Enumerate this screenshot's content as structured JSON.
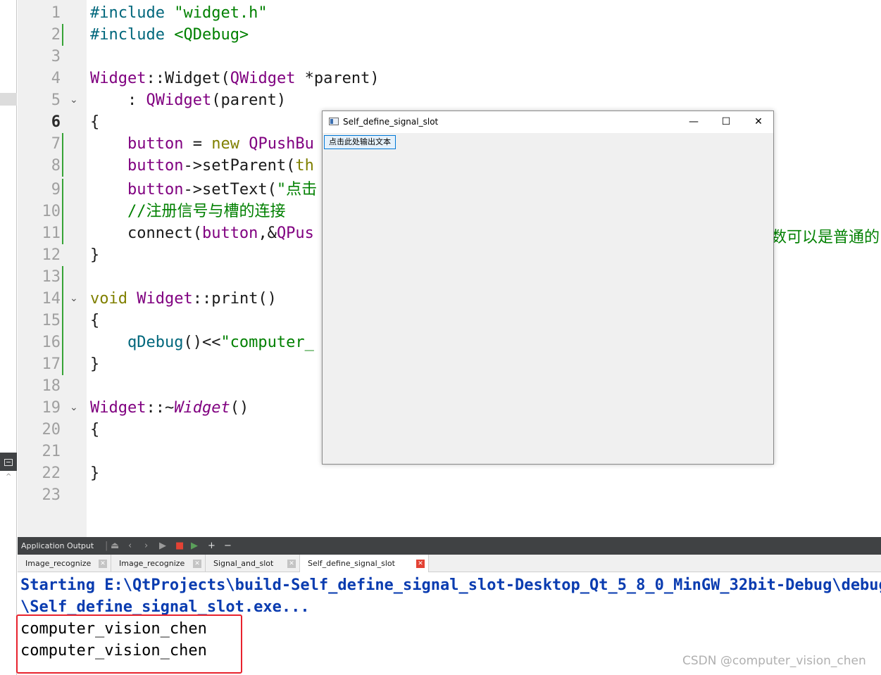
{
  "editor": {
    "lines": [
      {
        "n": "1",
        "code": [
          {
            "t": "#include ",
            "c": "pp"
          },
          {
            "t": "\"widget.h\"",
            "c": "str"
          }
        ]
      },
      {
        "n": "2",
        "code": [
          {
            "t": "#include ",
            "c": "pp"
          },
          {
            "t": "<QDebug>",
            "c": "str"
          }
        ]
      },
      {
        "n": "3",
        "code": []
      },
      {
        "n": "4",
        "code": [
          {
            "t": "Widget",
            "c": "ty"
          },
          {
            "t": "::",
            "c": ""
          },
          {
            "t": "Widget",
            "c": ""
          },
          {
            "t": "(",
            "c": ""
          },
          {
            "t": "QWidget",
            "c": "ty"
          },
          {
            "t": " *parent)",
            "c": ""
          }
        ]
      },
      {
        "n": "5",
        "fold": "⌄",
        "code": [
          {
            "t": "    : ",
            "c": ""
          },
          {
            "t": "QWidget",
            "c": "ty"
          },
          {
            "t": "(parent)",
            "c": ""
          }
        ]
      },
      {
        "n": "6",
        "current": true,
        "code": [
          {
            "t": "{",
            "c": ""
          }
        ]
      },
      {
        "n": "7",
        "code": [
          {
            "t": "    button",
            "c": "ty"
          },
          {
            "t": " = ",
            "c": ""
          },
          {
            "t": "new",
            "c": "kw"
          },
          {
            "t": " ",
            "c": ""
          },
          {
            "t": "QPushBu",
            "c": "ty"
          }
        ]
      },
      {
        "n": "8",
        "code": [
          {
            "t": "    button",
            "c": "ty"
          },
          {
            "t": "->setParent(",
            "c": ""
          },
          {
            "t": "th",
            "c": "kw"
          }
        ]
      },
      {
        "n": "9",
        "code": [
          {
            "t": "    button",
            "c": "ty"
          },
          {
            "t": "->setText(",
            "c": ""
          },
          {
            "t": "\"点击",
            "c": "str"
          }
        ]
      },
      {
        "n": "10",
        "code": [
          {
            "t": "    //注册信号与槽的连接",
            "c": "com"
          }
        ]
      },
      {
        "n": "11",
        "code": [
          {
            "t": "    connect(",
            "c": ""
          },
          {
            "t": "button",
            "c": "ty"
          },
          {
            "t": ",&",
            "c": ""
          },
          {
            "t": "QPus",
            "c": "ty"
          }
        ]
      },
      {
        "n": "12",
        "code": [
          {
            "t": "}",
            "c": ""
          }
        ]
      },
      {
        "n": "13",
        "code": []
      },
      {
        "n": "14",
        "fold": "⌄",
        "code": [
          {
            "t": "void",
            "c": "kw"
          },
          {
            "t": " ",
            "c": ""
          },
          {
            "t": "Widget",
            "c": "ty"
          },
          {
            "t": "::print()",
            "c": ""
          }
        ]
      },
      {
        "n": "15",
        "code": [
          {
            "t": "{",
            "c": ""
          }
        ]
      },
      {
        "n": "16",
        "code": [
          {
            "t": "    qDebug",
            "c": "fn"
          },
          {
            "t": "()<<",
            "c": ""
          },
          {
            "t": "\"computer_",
            "c": "str"
          }
        ]
      },
      {
        "n": "17",
        "code": [
          {
            "t": "}",
            "c": ""
          }
        ]
      },
      {
        "n": "18",
        "code": []
      },
      {
        "n": "19",
        "fold": "⌄",
        "code": [
          {
            "t": "Widget",
            "c": "ty"
          },
          {
            "t": "::~",
            "c": ""
          },
          {
            "t": "Widget",
            "c": "it"
          },
          {
            "t": "()",
            "c": ""
          }
        ]
      },
      {
        "n": "20",
        "code": [
          {
            "t": "{",
            "c": ""
          }
        ]
      },
      {
        "n": "21",
        "code": []
      },
      {
        "n": "22",
        "code": [
          {
            "t": "}",
            "c": ""
          }
        ]
      },
      {
        "n": "23",
        "code": []
      }
    ],
    "line11_tail": "数可以是普通的"
  },
  "qt_window": {
    "title": "Self_define_signal_slot",
    "minimize": "—",
    "maximize": "☐",
    "close": "✕",
    "push_button": "点击此处输出文本"
  },
  "output_panel": {
    "title": "Application Output",
    "tabs": [
      {
        "label": "Image_recognize",
        "active": false
      },
      {
        "label": "Image_recognize",
        "active": false
      },
      {
        "label": "Signal_and_slot",
        "active": false
      },
      {
        "label": "Self_define_signal_slot",
        "active": true
      }
    ],
    "lines": [
      "Starting E:\\QtProjects\\build-Self_define_signal_slot-Desktop_Qt_5_8_0_MinGW_32bit-Debug\\debug",
      "\\Self_define_signal_slot.exe...",
      "computer_vision_chen",
      "computer_vision_chen"
    ]
  },
  "watermark": "CSDN @computer_vision_chen",
  "colors": {
    "gutter_mark": "#36a336",
    "annotation_red": "#e8222d",
    "start_line_blue": "#0a3cb0"
  }
}
